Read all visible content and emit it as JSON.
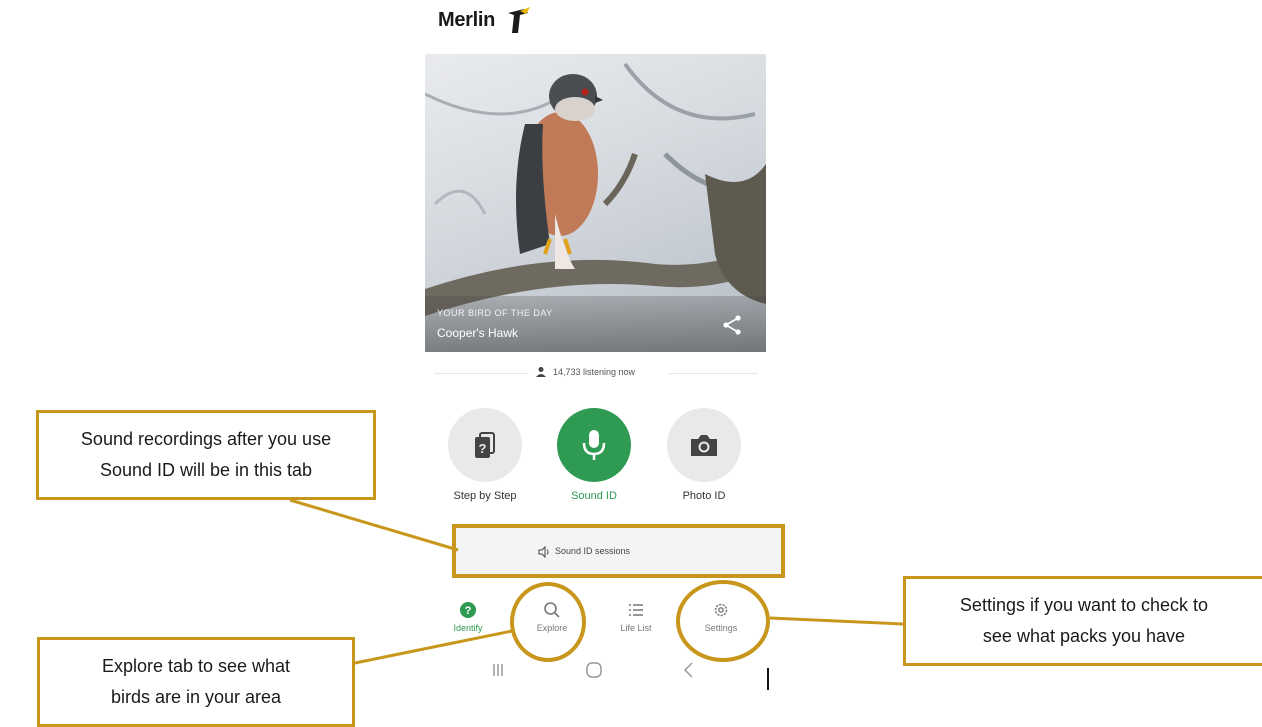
{
  "logo": {
    "text": "Merlin"
  },
  "hero": {
    "caption": "YOUR BIRD OF THE DAY",
    "bird_name": "Cooper's Hawk"
  },
  "listening": {
    "text": "14,733 listening now"
  },
  "id_buttons": [
    {
      "label": "Step by Step",
      "icon": "question-cards-icon"
    },
    {
      "label": "Sound ID",
      "icon": "microphone-icon"
    },
    {
      "label": "Photo ID",
      "icon": "camera-icon"
    }
  ],
  "sessions": {
    "label": "Sound ID sessions",
    "icon": "speaker-icon"
  },
  "bottom_nav": [
    {
      "label": "Identify",
      "icon": "identify-icon",
      "active": true
    },
    {
      "label": "Explore",
      "icon": "search-icon"
    },
    {
      "label": "Life List",
      "icon": "list-icon"
    },
    {
      "label": "Settings",
      "icon": "gear-icon"
    }
  ],
  "annotations": {
    "sound": "Sound recordings after you use\nSound ID will be in this tab",
    "explore": "Explore tab to see what\nbirds are in your area",
    "settings": "Settings if you want to check to\nsee what packs you have"
  },
  "colors": {
    "accent_green": "#2f9a52",
    "annotation_gold": "#c8961a"
  }
}
